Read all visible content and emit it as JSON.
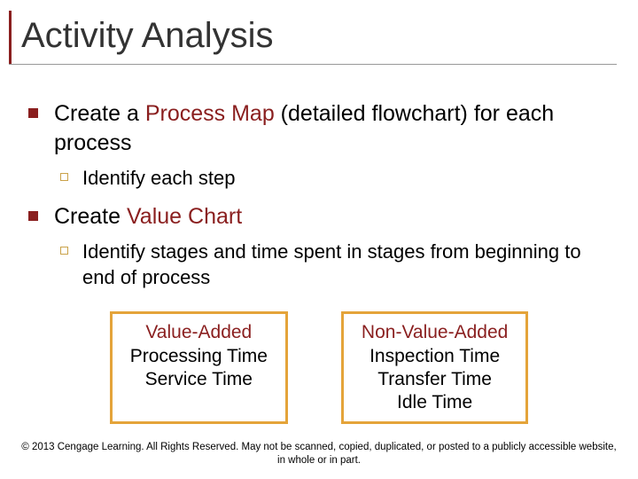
{
  "title": "Activity Analysis",
  "bullets": [
    {
      "prefix": "Create a ",
      "accent": "Process Map",
      "suffix": " (detailed flowchart) for each process",
      "sub": "Identify each step"
    },
    {
      "prefix": "Create ",
      "accent": "Value Chart",
      "suffix": "",
      "sub": "Identify stages and time spent in stages from beginning to end of process"
    }
  ],
  "boxes": [
    {
      "title": "Value-Added",
      "lines": [
        "Processing Time",
        "Service Time"
      ]
    },
    {
      "title": "Non-Value-Added",
      "lines": [
        "Inspection Time",
        "Transfer Time",
        "Idle Time"
      ]
    }
  ],
  "footer": "© 2013 Cengage Learning.  All Rights Reserved.  May not be scanned, copied, duplicated, or posted to a publicly accessible website, in whole or in part."
}
